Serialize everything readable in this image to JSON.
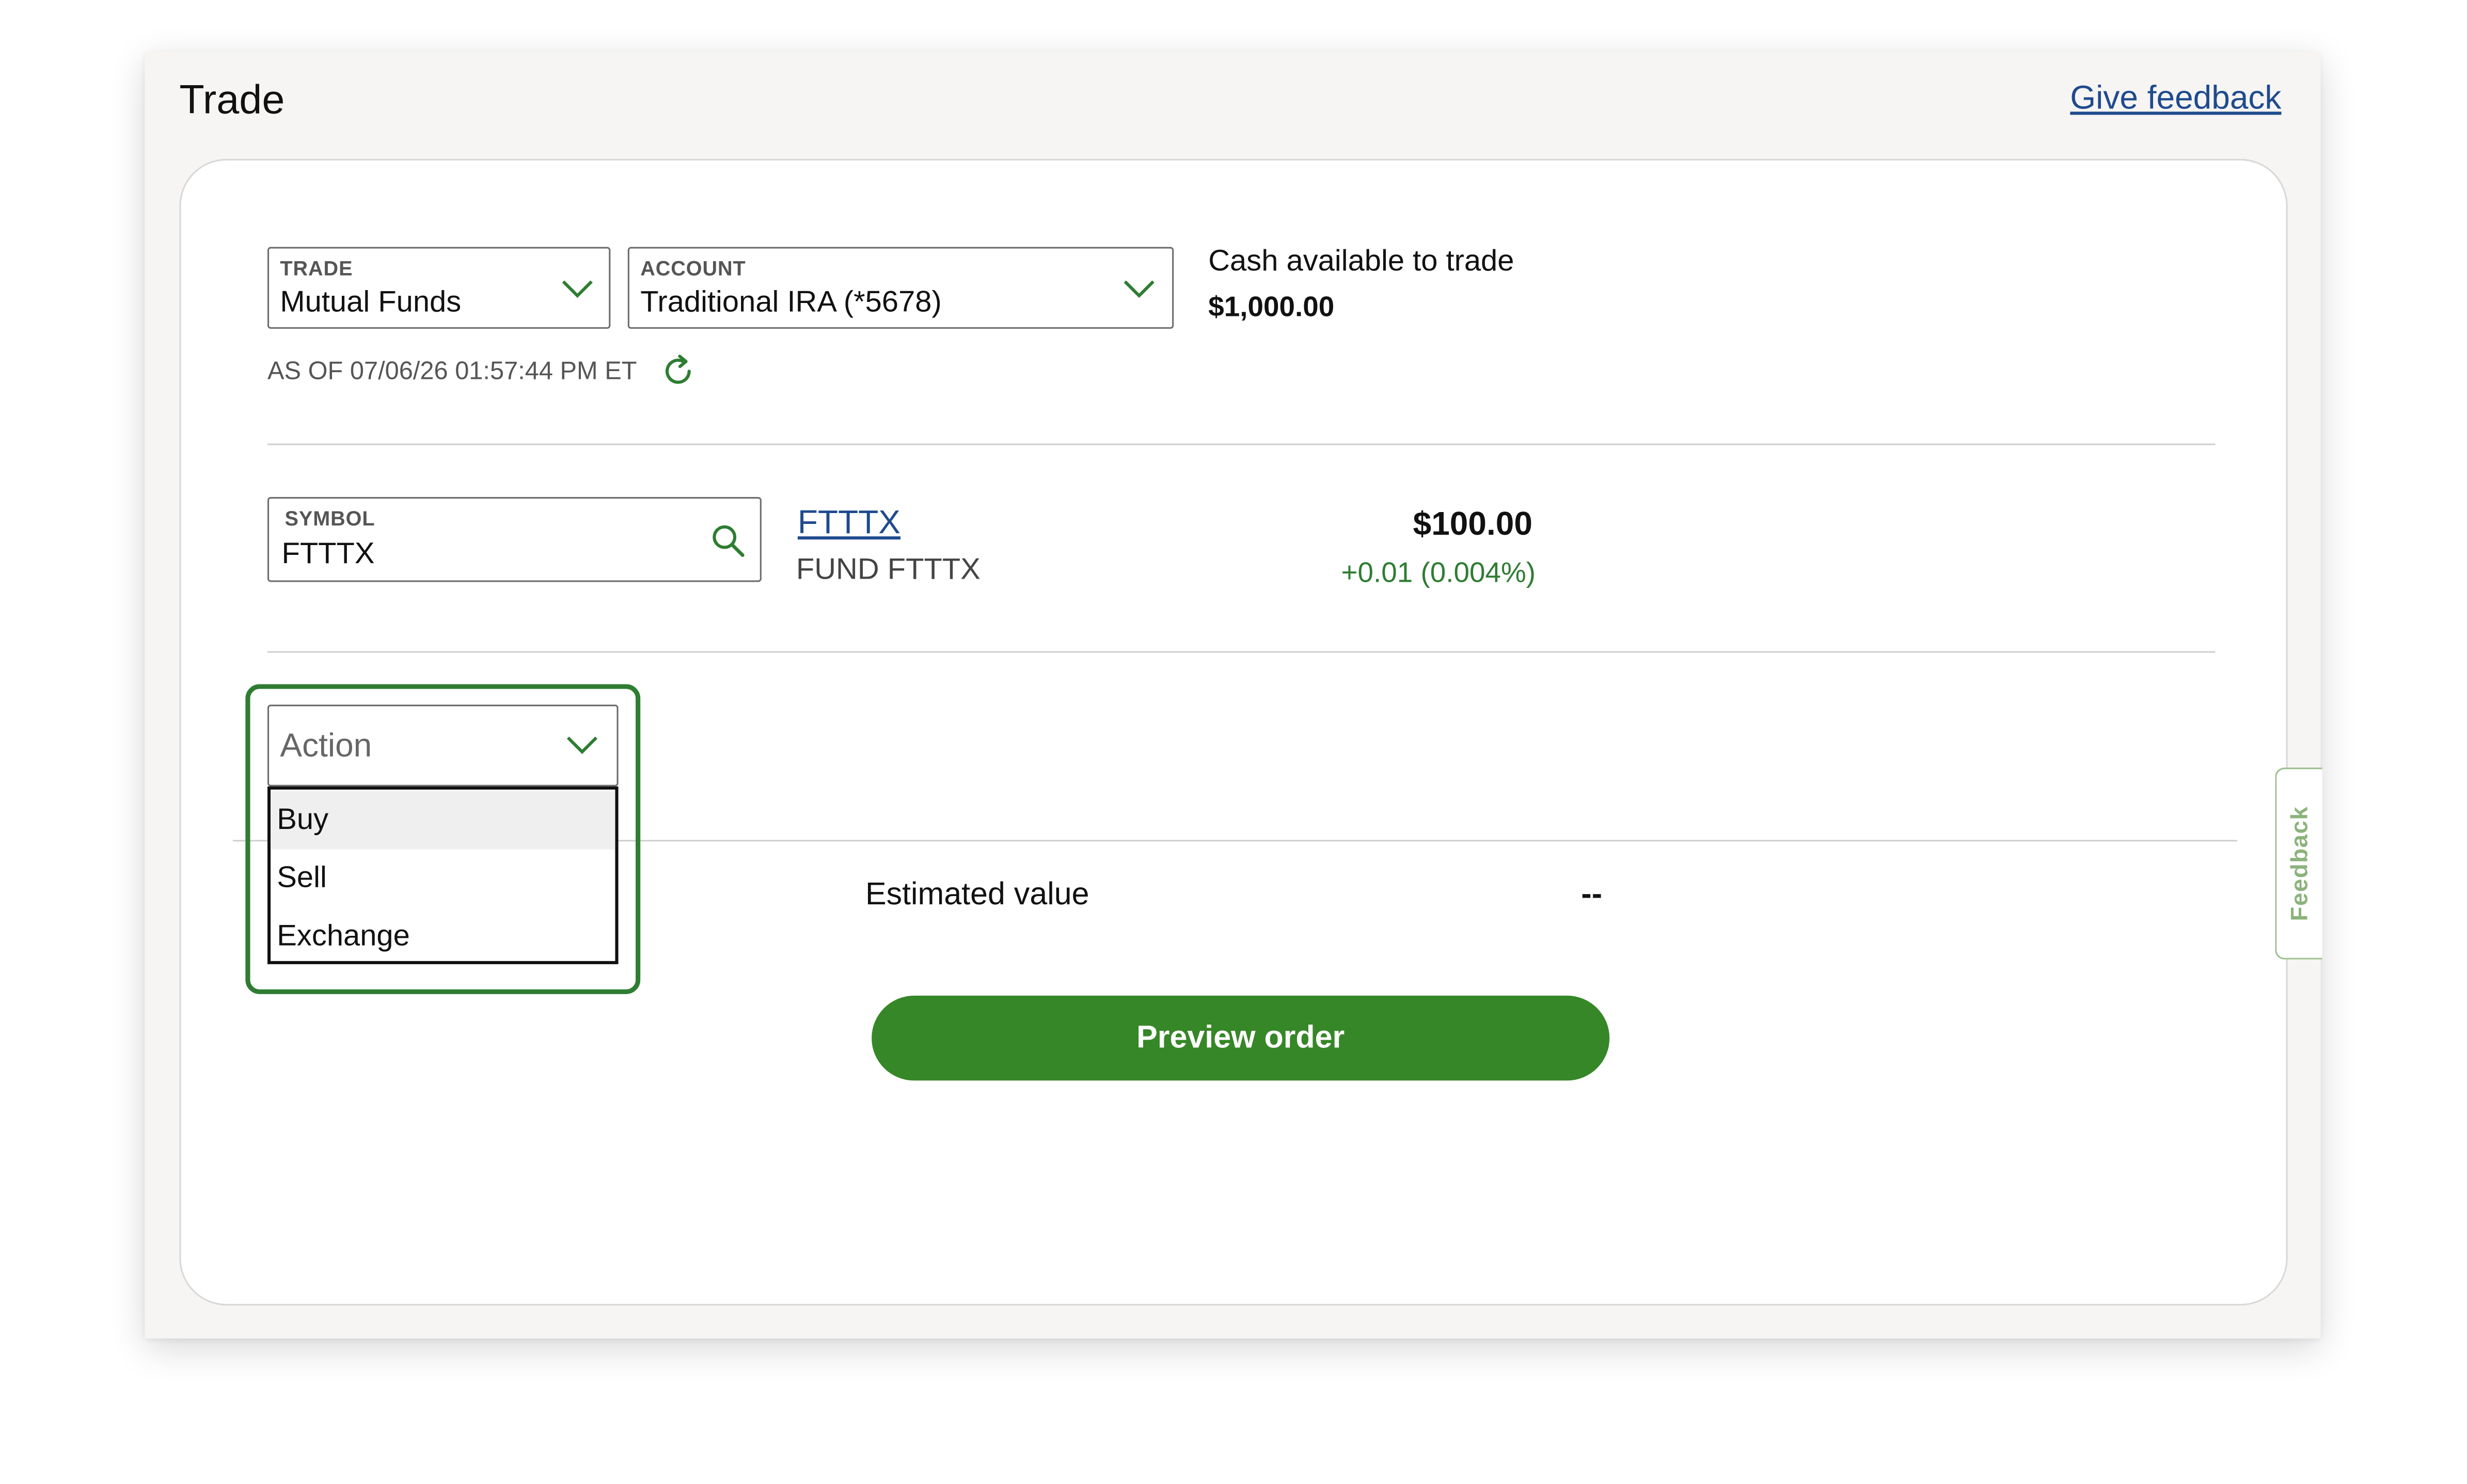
{
  "header": {
    "title": "Trade",
    "feedback_link": "Give feedback"
  },
  "trade_select": {
    "label": "TRADE",
    "value": "Mutual Funds"
  },
  "account_select": {
    "label": "ACCOUNT",
    "value": "Traditional IRA (*5678)"
  },
  "cash": {
    "label": "Cash available to trade",
    "value": "$1,000.00"
  },
  "as_of": "AS OF 07/06/26 01:57:44 PM ET",
  "symbol": {
    "label": "SYMBOL",
    "value": "FTTTX"
  },
  "quote": {
    "ticker": "FTTTX",
    "name": "FUND FTTTX",
    "price": "$100.00",
    "change": "+0.01 (0.004%)"
  },
  "action": {
    "placeholder": "Action",
    "options": [
      "Buy",
      "Sell",
      "Exchange"
    ],
    "highlighted": "Buy"
  },
  "estimate": {
    "label": "Estimated value",
    "value": "--"
  },
  "preview_button": "Preview order",
  "feedback_tab": "Feedback",
  "colors": {
    "brand_green": "#368727",
    "focus_green": "#2e7d32",
    "link_blue": "#1f4a8e",
    "gain_green": "#2e7d32"
  },
  "icons": {
    "trade_chevron": "chevron-down-icon",
    "account_chevron": "chevron-down-icon",
    "refresh": "refresh-icon",
    "search": "search-icon",
    "action_chevron": "chevron-down-icon"
  }
}
